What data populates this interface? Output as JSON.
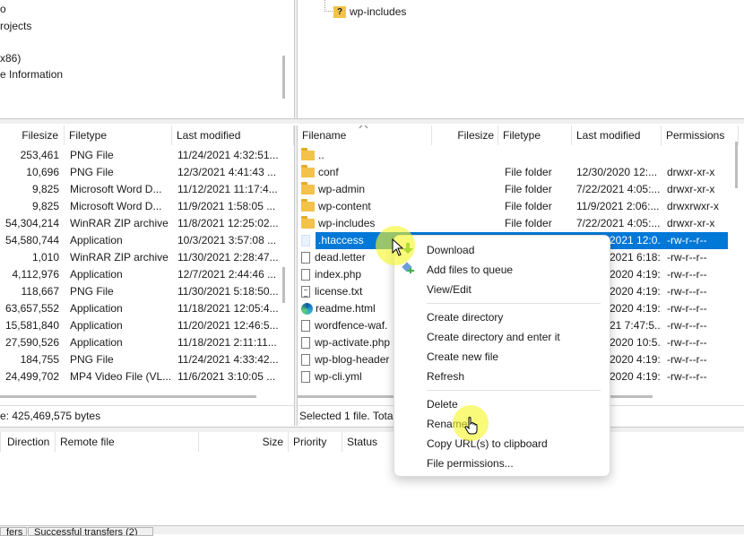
{
  "local_tree": {
    "items": [
      "o",
      "rojects",
      "x86)",
      "e Information"
    ]
  },
  "remote_tree": {
    "items": [
      {
        "label": "wp-includes",
        "icon": "unknown-folder-icon"
      }
    ]
  },
  "local_list": {
    "headers": {
      "filesize": "Filesize",
      "filetype": "Filetype",
      "last_modified": "Last modified"
    },
    "rows": [
      {
        "size": "253,461",
        "type": "PNG File",
        "modified": "11/24/2021 4:32:51..."
      },
      {
        "size": "10,696",
        "type": "PNG File",
        "modified": "12/3/2021 4:41:43 ..."
      },
      {
        "size": "9,825",
        "type": "Microsoft Word D...",
        "modified": "11/12/2021 11:17:4..."
      },
      {
        "size": "9,825",
        "type": "Microsoft Word D...",
        "modified": "11/9/2021 1:58:05 ..."
      },
      {
        "size": "54,304,214",
        "type": "WinRAR ZIP archive",
        "modified": "11/8/2021 12:25:02..."
      },
      {
        "size": "54,580,744",
        "type": "Application",
        "modified": "10/3/2021 3:57:08 ..."
      },
      {
        "size": "1,010",
        "type": "WinRAR ZIP archive",
        "modified": "11/30/2021 2:28:47..."
      },
      {
        "size": "4,112,976",
        "type": "Application",
        "modified": "12/7/2021 2:44:46 ..."
      },
      {
        "size": "118,667",
        "type": "PNG File",
        "modified": "11/30/2021 5:18:50..."
      },
      {
        "size": "63,657,552",
        "type": "Application",
        "modified": "11/18/2021 12:05:4..."
      },
      {
        "size": "15,581,840",
        "type": "Application",
        "modified": "11/20/2021 12:46:5..."
      },
      {
        "size": "27,590,526",
        "type": "Application",
        "modified": "11/18/2021 2:11:11..."
      },
      {
        "size": "184,755",
        "type": "PNG File",
        "modified": "11/24/2021 4:33:42..."
      },
      {
        "size": "24,499,702",
        "type": "MP4 Video File (VL...",
        "modified": "11/6/2021 3:10:05 ..."
      }
    ],
    "status": "e: 425,469,575 bytes"
  },
  "remote_list": {
    "headers": {
      "filename": "Filename",
      "filesize": "Filesize",
      "filetype": "Filetype",
      "last_modified": "Last modified",
      "permissions": "Permissions"
    },
    "rows": [
      {
        "name": "..",
        "icon": "folder",
        "type": "",
        "modified": "",
        "perms": ""
      },
      {
        "name": "conf",
        "icon": "folder",
        "type": "File folder",
        "modified": "12/30/2020 12:...",
        "perms": "drwxr-xr-x"
      },
      {
        "name": "wp-admin",
        "icon": "folder",
        "type": "File folder",
        "modified": "7/22/2021 4:05:...",
        "perms": "drwxr-xr-x"
      },
      {
        "name": "wp-content",
        "icon": "folder",
        "type": "File folder",
        "modified": "11/9/2021 2:06:...",
        "perms": "drwxrwxr-x"
      },
      {
        "name": "wp-includes",
        "icon": "folder",
        "type": "File folder",
        "modified": "7/22/2021 4:05:...",
        "perms": "drwxr-xr-x"
      },
      {
        "name": ".htaccess",
        "icon": "file",
        "type": "",
        "modified": "2021 12:0...",
        "perms": "-rw-r--r--",
        "selected": true
      },
      {
        "name": "dead.letter",
        "icon": "file",
        "type": "",
        "modified": "2021 6:18:...",
        "perms": "-rw-r--r--"
      },
      {
        "name": "index.php",
        "icon": "file",
        "type": "",
        "modified": "2020 4:19:...",
        "perms": "-rw-r--r--"
      },
      {
        "name": "license.txt",
        "icon": "file-lines",
        "type": "",
        "modified": "2020 4:19:...",
        "perms": "-rw-r--r--"
      },
      {
        "name": "readme.html",
        "icon": "edge",
        "type": "",
        "modified": "2020 4:19:...",
        "perms": "-rw-r--r--"
      },
      {
        "name": "wordfence-waf.",
        "icon": "file",
        "type": "",
        "modified": "21 7:47:5...",
        "perms": "-rw-r--r--"
      },
      {
        "name": "wp-activate.php",
        "icon": "file",
        "type": "",
        "modified": "2020 10:5...",
        "perms": "-rw-r--r--"
      },
      {
        "name": "wp-blog-header",
        "icon": "file",
        "type": "",
        "modified": "2020 4:19:...",
        "perms": "-rw-r--r--"
      },
      {
        "name": "wp-cli.yml",
        "icon": "file",
        "type": "",
        "modified": "2020 4:19:...",
        "perms": "-rw-r--r--"
      }
    ],
    "status": "Selected 1 file. Total"
  },
  "queue": {
    "headers": {
      "direction": "Direction",
      "remote_file": "Remote file",
      "size": "Size",
      "priority": "Priority",
      "status": "Status"
    },
    "tabs": [
      "fers",
      "Successful transfers (2)"
    ]
  },
  "context_menu": {
    "items": [
      {
        "label": "Download",
        "icon": "download-icon"
      },
      {
        "label": "Add files to queue",
        "icon": "add-to-queue-icon"
      },
      {
        "label": "View/Edit"
      },
      {
        "label": "Create directory"
      },
      {
        "label": "Create directory and enter it"
      },
      {
        "label": "Create new file"
      },
      {
        "label": "Refresh"
      },
      {
        "label": "Delete"
      },
      {
        "label": "Rename"
      },
      {
        "label": "Copy URL(s) to clipboard"
      },
      {
        "label": "File permissions..."
      }
    ]
  },
  "colors": {
    "selection": "#0078d7",
    "highlight": "#f5f528"
  }
}
